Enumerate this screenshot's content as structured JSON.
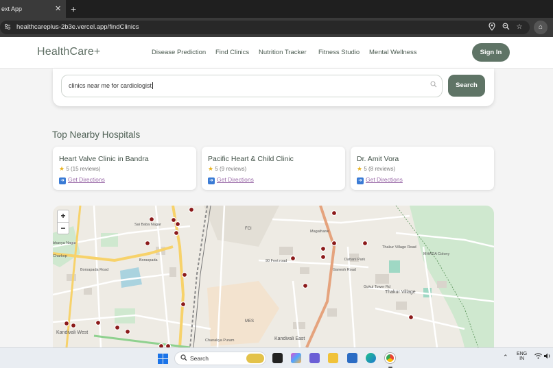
{
  "browser": {
    "tab_title": "ext App",
    "tab_close": "✕",
    "new_tab": "+",
    "url": "healthcareplus-2b3e.vercel.app/findClinics"
  },
  "header": {
    "logo": "HealthCare+",
    "nav": [
      "Disease Prediction",
      "Find Clinics",
      "Nutrition Tracker",
      "Fitness Studio",
      "Mental Wellness"
    ],
    "sign_in": "Sign In"
  },
  "search": {
    "value": "clinics near me for cardiologist",
    "button": "Search"
  },
  "hospitals": {
    "title": "Top Nearby Hospitals",
    "items": [
      {
        "name": "Heart Valve Clinic in Bandra",
        "rating": "5 (15 reviews)",
        "directions": "Get Directions"
      },
      {
        "name": "Pacific Heart & Child Clinic",
        "rating": "5 (9 reviews)",
        "directions": "Get Directions"
      },
      {
        "name": "Dr. Amit Vora",
        "rating": "5 (8 reviews)",
        "directions": "Get Directions"
      }
    ]
  },
  "map": {
    "zoom_in": "+",
    "zoom_out": "−",
    "labels": {
      "sai_baba": "Sai Baba Nagar",
      "borsapada": "Borsapada Road",
      "boraspada": "Boraspada",
      "fci": "FCI",
      "magathane": "Magathane",
      "feet90": "90 Feet road",
      "ganesh": "Ganesh Road",
      "dattani": "Dattani Park",
      "thakur_road": "Thakur Village Road",
      "thakur": "Thakur Village",
      "gokul": "Gokul Tower Rd",
      "mhada": "MHADA Colony",
      "kandivali_w": "Kandivali West",
      "kandivali_e": "Kandivali East",
      "mes": "MES",
      "chanakya": "Chanakya Puram",
      "charkop": "Charkop",
      "bhavya": "bhavya Nagar"
    }
  },
  "taskbar": {
    "search": "Search",
    "lang": "ENG",
    "region": "IN"
  }
}
